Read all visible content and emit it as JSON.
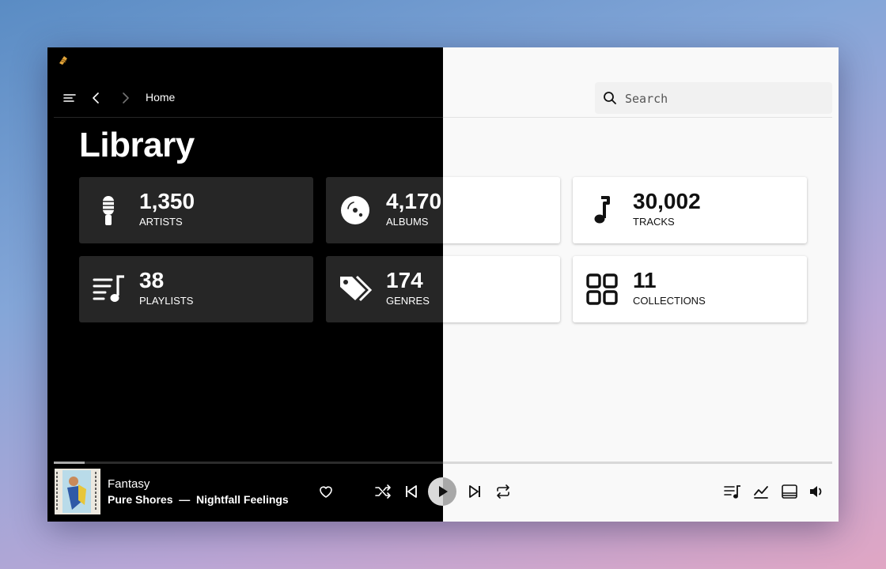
{
  "header": {
    "breadcrumb": "Home",
    "search_placeholder": "Search"
  },
  "page": {
    "title": "Library"
  },
  "stats": [
    {
      "value": "1,350",
      "label": "ARTISTS",
      "icon": "microphone-icon"
    },
    {
      "value": "4,170",
      "label": "ALBUMS",
      "icon": "album-disc-icon"
    },
    {
      "value": "30,002",
      "label": "TRACKS",
      "icon": "music-note-icon"
    },
    {
      "value": "38",
      "label": "PLAYLISTS",
      "icon": "playlist-icon"
    },
    {
      "value": "174",
      "label": "GENRES",
      "icon": "tag-icon"
    },
    {
      "value": "11",
      "label": "COLLECTIONS",
      "icon": "collections-grid-icon"
    }
  ],
  "player": {
    "title": "Fantasy",
    "artist": "Pure Shores",
    "separator": "—",
    "album": "Nightfall Feelings",
    "progress": 0.04
  },
  "colors": {
    "dark_bg": "#000000",
    "dark_card": "#262626",
    "light_bg": "#f9f9f9",
    "light_card": "#ffffff",
    "logo_accent": "#e0a43a"
  }
}
